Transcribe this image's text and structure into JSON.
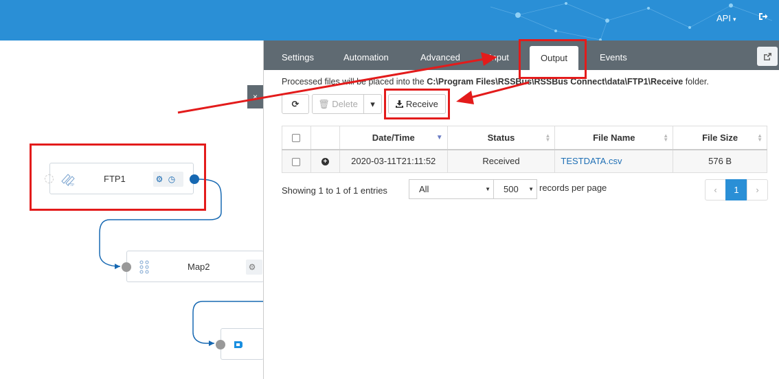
{
  "header": {
    "api_label": "API",
    "caret": "▾",
    "logout_icon": "logout-icon"
  },
  "canvas": {
    "nodes": [
      {
        "label": "FTP1",
        "icon": "ftp-icon"
      },
      {
        "label": "Map2",
        "icon": "map-icon"
      },
      {
        "label": "",
        "icon": "connector-icon"
      }
    ],
    "collapse_glyph": "×"
  },
  "panel": {
    "tabs": [
      {
        "label": "Settings"
      },
      {
        "label": "Automation"
      },
      {
        "label": "Advanced"
      },
      {
        "label": "Input"
      },
      {
        "label": "Output"
      },
      {
        "label": "Events"
      }
    ],
    "active_tab": "Output",
    "info": {
      "prefix": "Processed files will be placed into the ",
      "path": "C:\\Program Files\\RSSBus\\RSSBus Connect\\data\\FTP1\\Receive",
      "suffix": " folder."
    },
    "toolbar": {
      "refresh_glyph": "⟳",
      "delete_label": "Delete",
      "dropdown_glyph": "▾",
      "receive_label": "Receive"
    },
    "table": {
      "headers": [
        "Date/Time",
        "Status",
        "File Name",
        "File Size"
      ],
      "rows": [
        {
          "datetime": "2020-03-11T21:11:52",
          "status": "Received",
          "file_name": "TESTDATA.csv",
          "file_size": "576 B"
        }
      ]
    },
    "footer": {
      "showing": "Showing 1 to 1 of 1 entries",
      "filter_value": "All",
      "page_size": "500",
      "records_per_page": "records per page",
      "prev": "‹",
      "current_page": "1",
      "next": "›"
    }
  },
  "colors": {
    "header_blue": "#2a8fd6",
    "tabbar_gray": "#5f6a72",
    "annotation_red": "#e31b1b",
    "port_blue": "#1668b2"
  }
}
